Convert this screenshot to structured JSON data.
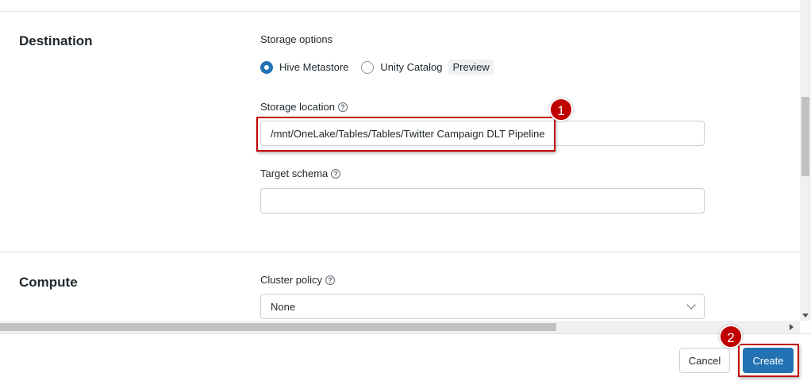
{
  "destination": {
    "title": "Destination",
    "storage_options_label": "Storage options",
    "options": [
      {
        "label": "Hive Metastore",
        "checked": true
      },
      {
        "label": "Unity Catalog",
        "checked": false,
        "tag": "Preview"
      }
    ],
    "storage_location_label": "Storage location",
    "storage_location_value": "/mnt/OneLake/Tables/Tables/Twitter Campaign DLT Pipeline",
    "target_schema_label": "Target schema",
    "target_schema_value": ""
  },
  "compute": {
    "title": "Compute",
    "cluster_policy_label": "Cluster policy",
    "cluster_policy_value": "None"
  },
  "footer": {
    "cancel_label": "Cancel",
    "create_label": "Create"
  },
  "annotations": {
    "callout_1": "1",
    "callout_2": "2"
  },
  "icons": {
    "help": "?",
    "help_icon_name": "help-circle-icon"
  },
  "colors": {
    "primary": "#2272b4",
    "annotation": "#c00000"
  }
}
